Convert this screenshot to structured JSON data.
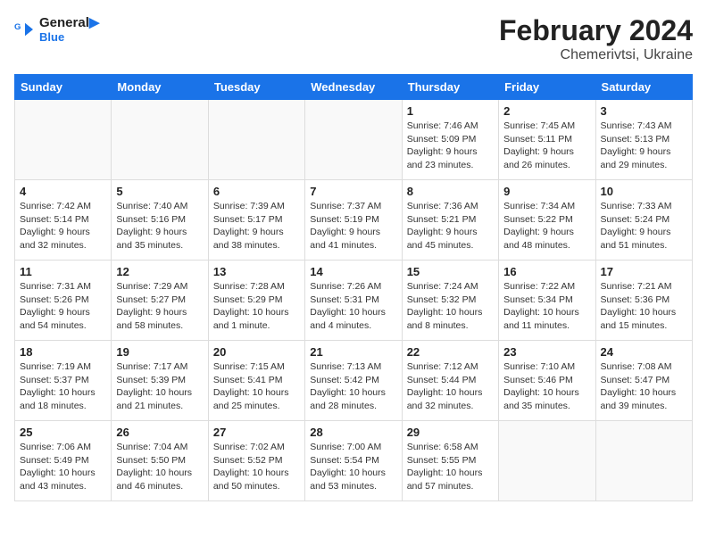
{
  "header": {
    "logo_line1": "General",
    "logo_line2": "Blue",
    "title": "February 2024",
    "subtitle": "Chemerivtsi, Ukraine"
  },
  "days_of_week": [
    "Sunday",
    "Monday",
    "Tuesday",
    "Wednesday",
    "Thursday",
    "Friday",
    "Saturday"
  ],
  "weeks": [
    [
      {
        "day": "",
        "info": ""
      },
      {
        "day": "",
        "info": ""
      },
      {
        "day": "",
        "info": ""
      },
      {
        "day": "",
        "info": ""
      },
      {
        "day": "1",
        "info": "Sunrise: 7:46 AM\nSunset: 5:09 PM\nDaylight: 9 hours\nand 23 minutes."
      },
      {
        "day": "2",
        "info": "Sunrise: 7:45 AM\nSunset: 5:11 PM\nDaylight: 9 hours\nand 26 minutes."
      },
      {
        "day": "3",
        "info": "Sunrise: 7:43 AM\nSunset: 5:13 PM\nDaylight: 9 hours\nand 29 minutes."
      }
    ],
    [
      {
        "day": "4",
        "info": "Sunrise: 7:42 AM\nSunset: 5:14 PM\nDaylight: 9 hours\nand 32 minutes."
      },
      {
        "day": "5",
        "info": "Sunrise: 7:40 AM\nSunset: 5:16 PM\nDaylight: 9 hours\nand 35 minutes."
      },
      {
        "day": "6",
        "info": "Sunrise: 7:39 AM\nSunset: 5:17 PM\nDaylight: 9 hours\nand 38 minutes."
      },
      {
        "day": "7",
        "info": "Sunrise: 7:37 AM\nSunset: 5:19 PM\nDaylight: 9 hours\nand 41 minutes."
      },
      {
        "day": "8",
        "info": "Sunrise: 7:36 AM\nSunset: 5:21 PM\nDaylight: 9 hours\nand 45 minutes."
      },
      {
        "day": "9",
        "info": "Sunrise: 7:34 AM\nSunset: 5:22 PM\nDaylight: 9 hours\nand 48 minutes."
      },
      {
        "day": "10",
        "info": "Sunrise: 7:33 AM\nSunset: 5:24 PM\nDaylight: 9 hours\nand 51 minutes."
      }
    ],
    [
      {
        "day": "11",
        "info": "Sunrise: 7:31 AM\nSunset: 5:26 PM\nDaylight: 9 hours\nand 54 minutes."
      },
      {
        "day": "12",
        "info": "Sunrise: 7:29 AM\nSunset: 5:27 PM\nDaylight: 9 hours\nand 58 minutes."
      },
      {
        "day": "13",
        "info": "Sunrise: 7:28 AM\nSunset: 5:29 PM\nDaylight: 10 hours\nand 1 minute."
      },
      {
        "day": "14",
        "info": "Sunrise: 7:26 AM\nSunset: 5:31 PM\nDaylight: 10 hours\nand 4 minutes."
      },
      {
        "day": "15",
        "info": "Sunrise: 7:24 AM\nSunset: 5:32 PM\nDaylight: 10 hours\nand 8 minutes."
      },
      {
        "day": "16",
        "info": "Sunrise: 7:22 AM\nSunset: 5:34 PM\nDaylight: 10 hours\nand 11 minutes."
      },
      {
        "day": "17",
        "info": "Sunrise: 7:21 AM\nSunset: 5:36 PM\nDaylight: 10 hours\nand 15 minutes."
      }
    ],
    [
      {
        "day": "18",
        "info": "Sunrise: 7:19 AM\nSunset: 5:37 PM\nDaylight: 10 hours\nand 18 minutes."
      },
      {
        "day": "19",
        "info": "Sunrise: 7:17 AM\nSunset: 5:39 PM\nDaylight: 10 hours\nand 21 minutes."
      },
      {
        "day": "20",
        "info": "Sunrise: 7:15 AM\nSunset: 5:41 PM\nDaylight: 10 hours\nand 25 minutes."
      },
      {
        "day": "21",
        "info": "Sunrise: 7:13 AM\nSunset: 5:42 PM\nDaylight: 10 hours\nand 28 minutes."
      },
      {
        "day": "22",
        "info": "Sunrise: 7:12 AM\nSunset: 5:44 PM\nDaylight: 10 hours\nand 32 minutes."
      },
      {
        "day": "23",
        "info": "Sunrise: 7:10 AM\nSunset: 5:46 PM\nDaylight: 10 hours\nand 35 minutes."
      },
      {
        "day": "24",
        "info": "Sunrise: 7:08 AM\nSunset: 5:47 PM\nDaylight: 10 hours\nand 39 minutes."
      }
    ],
    [
      {
        "day": "25",
        "info": "Sunrise: 7:06 AM\nSunset: 5:49 PM\nDaylight: 10 hours\nand 43 minutes."
      },
      {
        "day": "26",
        "info": "Sunrise: 7:04 AM\nSunset: 5:50 PM\nDaylight: 10 hours\nand 46 minutes."
      },
      {
        "day": "27",
        "info": "Sunrise: 7:02 AM\nSunset: 5:52 PM\nDaylight: 10 hours\nand 50 minutes."
      },
      {
        "day": "28",
        "info": "Sunrise: 7:00 AM\nSunset: 5:54 PM\nDaylight: 10 hours\nand 53 minutes."
      },
      {
        "day": "29",
        "info": "Sunrise: 6:58 AM\nSunset: 5:55 PM\nDaylight: 10 hours\nand 57 minutes."
      },
      {
        "day": "",
        "info": ""
      },
      {
        "day": "",
        "info": ""
      }
    ]
  ]
}
